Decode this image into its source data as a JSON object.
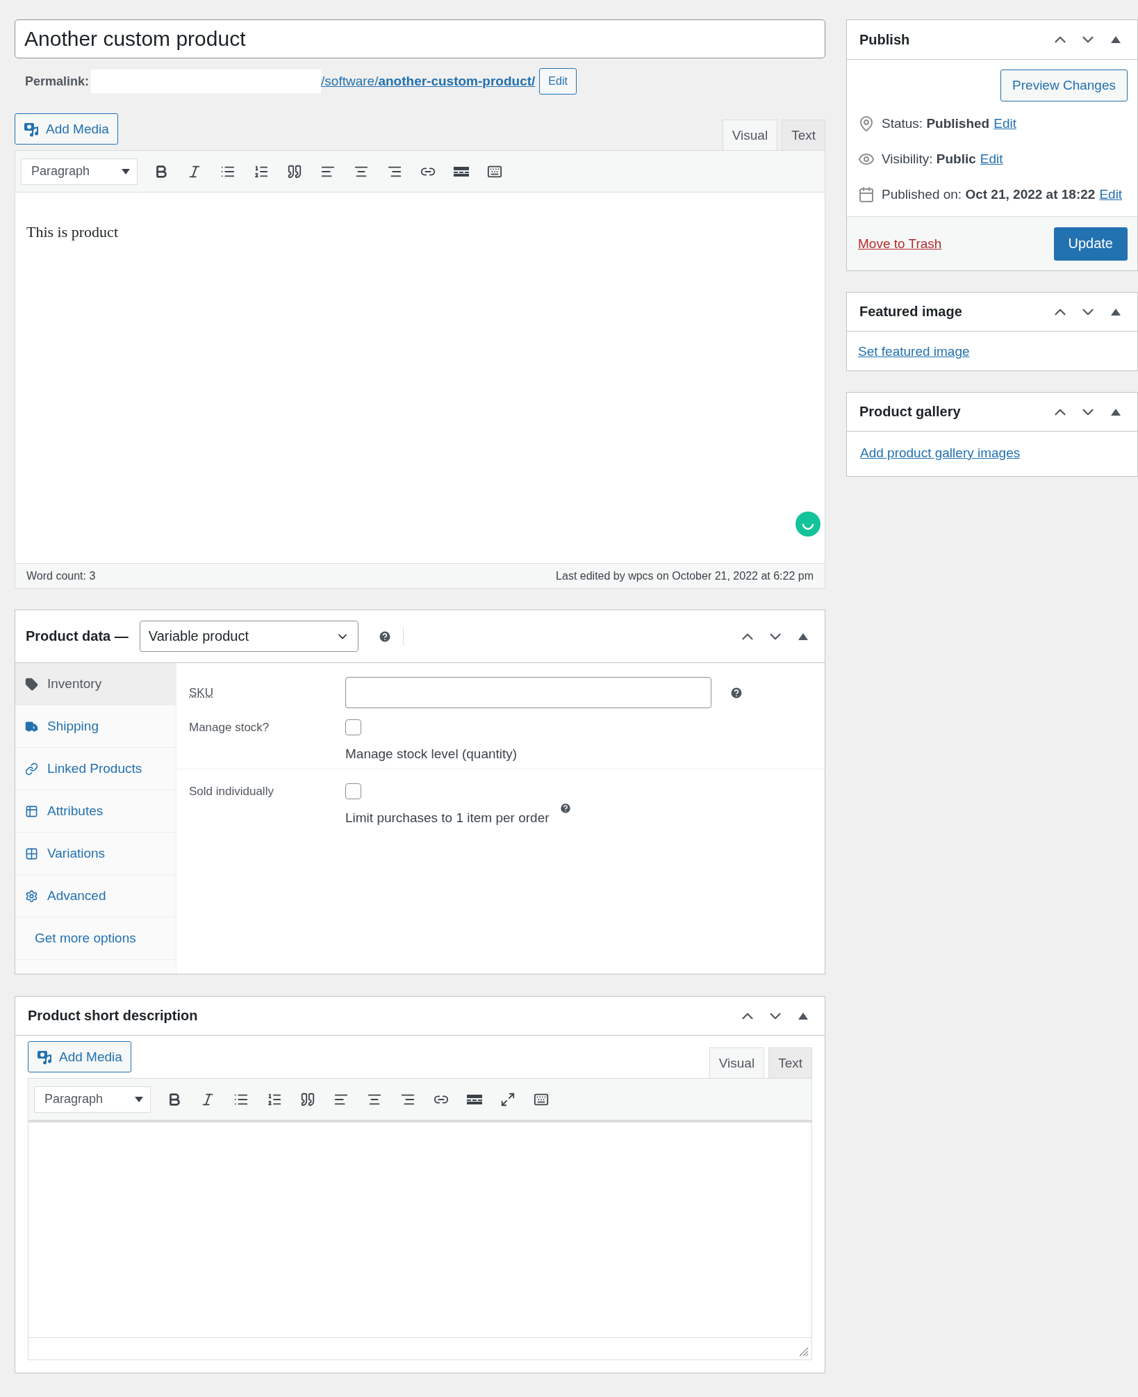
{
  "title_field": {
    "value": "Another custom product"
  },
  "permalink": {
    "label": "Permalink:",
    "path": "/software/",
    "slug": "another-custom-product/",
    "edit_button": "Edit"
  },
  "editor": {
    "add_media": "Add Media",
    "tabs": [
      {
        "label": "Visual",
        "selected": true
      },
      {
        "label": "Text",
        "selected": false
      }
    ],
    "format_select": "Paragraph",
    "toolbar": [
      {
        "kind": "bold"
      },
      {
        "kind": "italic"
      },
      {
        "kind": "bullets"
      },
      {
        "kind": "numbers"
      },
      {
        "kind": "quote"
      },
      {
        "kind": "align-left"
      },
      {
        "kind": "align-center"
      },
      {
        "kind": "align-right"
      },
      {
        "kind": "link"
      },
      {
        "kind": "more"
      },
      {
        "kind": "toolbar-toggle"
      }
    ],
    "content": "This is product",
    "word_count": "Word count: 3",
    "last_edited": "Last edited by wpcs on October 21, 2022 at 6:22 pm"
  },
  "product_data": {
    "title": "Product data —",
    "type_select": "Variable product",
    "tabs": [
      {
        "label": "Inventory",
        "kind": "tag",
        "selected": true
      },
      {
        "label": "Shipping",
        "kind": "truck",
        "selected": false
      },
      {
        "label": "Linked Products",
        "kind": "link",
        "selected": false
      },
      {
        "label": "Attributes",
        "kind": "list",
        "selected": false
      },
      {
        "label": "Variations",
        "kind": "grid",
        "selected": false
      },
      {
        "label": "Advanced",
        "kind": "gear",
        "selected": false
      },
      {
        "label": "Get more options",
        "kind": "plain",
        "selected": false
      }
    ],
    "sku_label": "SKU",
    "manage_stock": {
      "label": "Manage stock?",
      "checked": false,
      "description": "Manage stock level (quantity)"
    },
    "sold_individually": {
      "label": "Sold individually",
      "checked": false,
      "description": "Limit purchases to 1 item per order"
    }
  },
  "short_description": {
    "title": "Product short description",
    "add_media": "Add Media",
    "tabs": [
      {
        "label": "Visual",
        "selected": true
      },
      {
        "label": "Text",
        "selected": false
      }
    ],
    "format_select": "Paragraph",
    "toolbar": [
      {
        "kind": "bold"
      },
      {
        "kind": "italic"
      },
      {
        "kind": "bullets"
      },
      {
        "kind": "numbers"
      },
      {
        "kind": "quote"
      },
      {
        "kind": "align-left"
      },
      {
        "kind": "align-center"
      },
      {
        "kind": "align-right"
      },
      {
        "kind": "link"
      },
      {
        "kind": "more"
      },
      {
        "kind": "fullscreen"
      },
      {
        "kind": "toolbar-toggle"
      }
    ]
  },
  "publish": {
    "title": "Publish",
    "preview_button": "Preview Changes",
    "rows": [
      {
        "kind": "pin",
        "text": "Status: **Published**",
        "edit": "Edit"
      },
      {
        "kind": "eye",
        "text": "Visibility: **Public**",
        "edit": "Edit"
      },
      {
        "kind": "calendar",
        "text": "Published on: **Oct 21, 2022 at 18:22**",
        "edit": "Edit"
      }
    ],
    "trash_link": "Move to Trash",
    "update_button": "Update"
  },
  "featured_image": {
    "title": "Featured image",
    "link": "Set featured image"
  },
  "product_gallery": {
    "title": "Product gallery",
    "link": "Add product gallery images"
  }
}
